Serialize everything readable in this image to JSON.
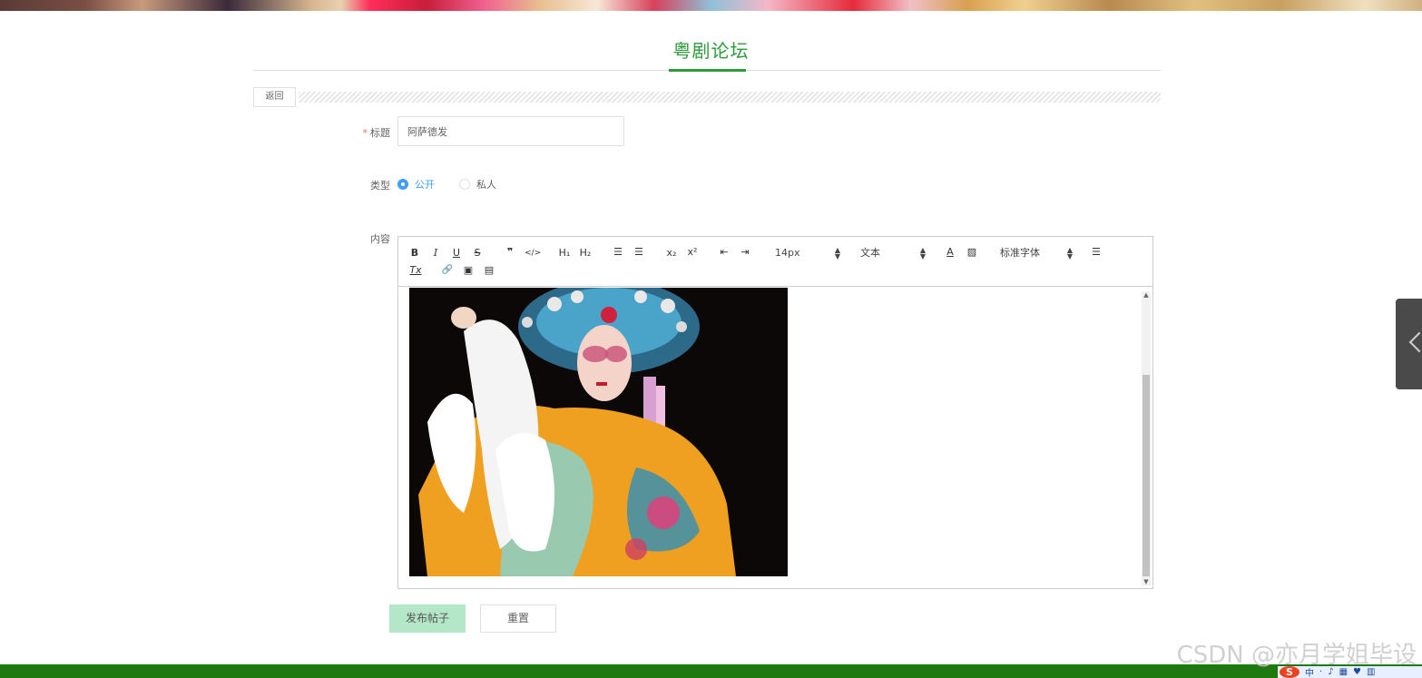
{
  "page": {
    "title": "粤剧论坛",
    "back_label": "返回"
  },
  "form": {
    "title_label": "标题",
    "title_value": "阿萨德发",
    "type_label": "类型",
    "type_options": [
      "公开",
      "私人"
    ],
    "type_selected": "公开",
    "content_label": "内容"
  },
  "editor": {
    "font_size": "14px",
    "block_format": "文本",
    "font_family": "标准字体",
    "buttons": {
      "bold": "B",
      "italic": "I",
      "underline": "U",
      "strike": "S",
      "blockquote": "❞",
      "code": "</>",
      "h1": "H₁",
      "h2": "H₂",
      "ordered_list": "☰",
      "bullet_list": "☰",
      "subscript": "x₂",
      "superscript": "x²",
      "outdent": "⇤",
      "indent": "⇥",
      "color": "A",
      "background": "▨",
      "align": "☰",
      "clean": "Tx",
      "link": "🔗",
      "image": "▣",
      "video": "▤"
    }
  },
  "actions": {
    "submit": "发布帖子",
    "reset": "重置"
  },
  "watermark": "CSDN @亦月学姐毕设",
  "ime": {
    "logo": "S",
    "items": [
      "中",
      "·",
      "♪",
      "▦",
      "♥",
      "▥"
    ]
  },
  "colors": {
    "accent_green": "#2e9a3a",
    "footer_green": "#1e7a10",
    "radio_blue": "#409eff",
    "submit_bg": "#b4e6c8"
  }
}
